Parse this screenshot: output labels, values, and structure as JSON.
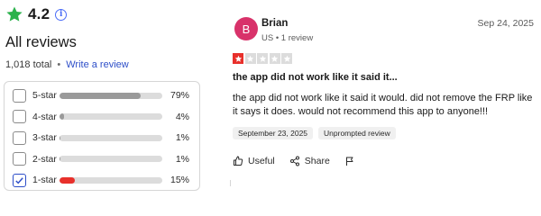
{
  "summary": {
    "average_rating": "4.2",
    "star_icon": "star-icon",
    "info_icon": "info-icon",
    "heading": "All reviews",
    "total": "1,018 total",
    "write_review_link": "Write a review",
    "accent_color": "#2d4ec8",
    "star_color": "#2bb24c"
  },
  "distribution": [
    {
      "label": "5-star",
      "percent_text": "79%",
      "percent": 79,
      "checked": false,
      "color": "#9a9a9a"
    },
    {
      "label": "4-star",
      "percent_text": "4%",
      "percent": 4,
      "checked": false,
      "color": "#9a9a9a"
    },
    {
      "label": "3-star",
      "percent_text": "1%",
      "percent": 1,
      "checked": false,
      "color": "#9a9a9a"
    },
    {
      "label": "2-star",
      "percent_text": "1%",
      "percent": 1,
      "checked": false,
      "color": "#9a9a9a"
    },
    {
      "label": "1-star",
      "percent_text": "15%",
      "percent": 15,
      "checked": true,
      "color": "#e8302b"
    }
  ],
  "review": {
    "avatar_letter": "B",
    "avatar_color": "#d8326a",
    "name": "Brian",
    "meta": "US • 1 review",
    "date": "Sep 24, 2025",
    "rating": 1,
    "max_rating": 5,
    "title": "the app did not work like it said it...",
    "body": "the app did not work like it said it would. did not remove the FRP like it says it does. would not recommend this app to anyone!!!",
    "chips": [
      "September 23, 2025",
      "Unprompted review"
    ],
    "actions": {
      "useful": "Useful",
      "share": "Share",
      "flag_icon": "flag-icon"
    }
  }
}
